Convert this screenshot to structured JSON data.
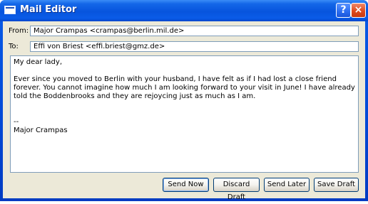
{
  "window": {
    "title": "Mail Editor",
    "help_label": "?",
    "close_label": "×"
  },
  "from": {
    "label": "From:",
    "value": "Major Crampas <crampas@berlin.mil.de>"
  },
  "to": {
    "label": "To:",
    "value": "Effi von Briest <effi.briest@gmz.de>"
  },
  "message": {
    "greeting": "My dear lady,",
    "paragraph": "Ever since you moved to Berlin with your husband, I have felt as if I had lost a close friend forever. You cannot imagine how much I am looking forward to your visit in June! I have already told the Boddenbrooks and they are rejoycing just as much as I am.",
    "signature_separator": "--",
    "signature_name": "Major Crampas"
  },
  "buttons": {
    "send_now": "Send Now",
    "discard_draft": "Discard Draft",
    "send_later": "Send Later",
    "save_draft": "Save Draft"
  },
  "colors": {
    "titlebar": "#0754dd",
    "client_background": "#ece9d8",
    "field_border": "#7f9db9"
  }
}
